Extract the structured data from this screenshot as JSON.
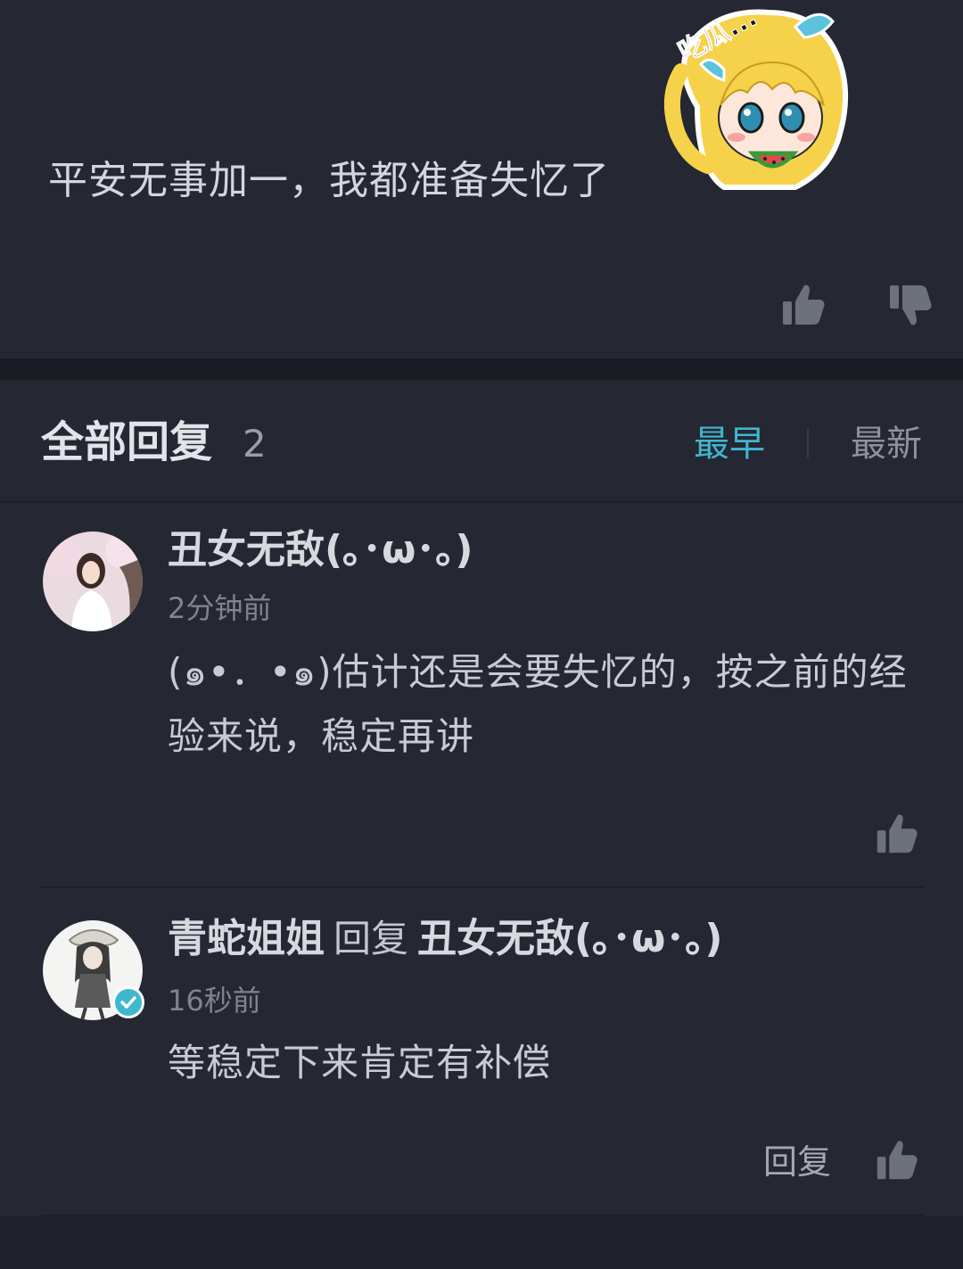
{
  "post": {
    "text": "平安无事加一，我都准备失忆了",
    "sticker_text": "吃瓜..."
  },
  "replies_header": {
    "title": "全部回复",
    "count": "2",
    "sort_earliest": "最早",
    "sort_latest": "最新",
    "active_sort_color": "#3fb7cf"
  },
  "replies": [
    {
      "username": "丑女无敌(｡･ω･｡)",
      "time": "2分钟前",
      "body": "(๑•．•๑)估计还是会要失忆的，按之前的经验来说，稳定再讲"
    },
    {
      "username": "青蛇姐姐",
      "reply_word": "回复",
      "reply_to": "丑女无敌(｡･ω･｡)",
      "time": "16秒前",
      "body": "等稳定下来肯定有补偿",
      "reply_action": "回复",
      "verified": true
    }
  ],
  "icons": [
    "thumbs-up-icon",
    "thumbs-down-icon",
    "verified-check-icon"
  ]
}
